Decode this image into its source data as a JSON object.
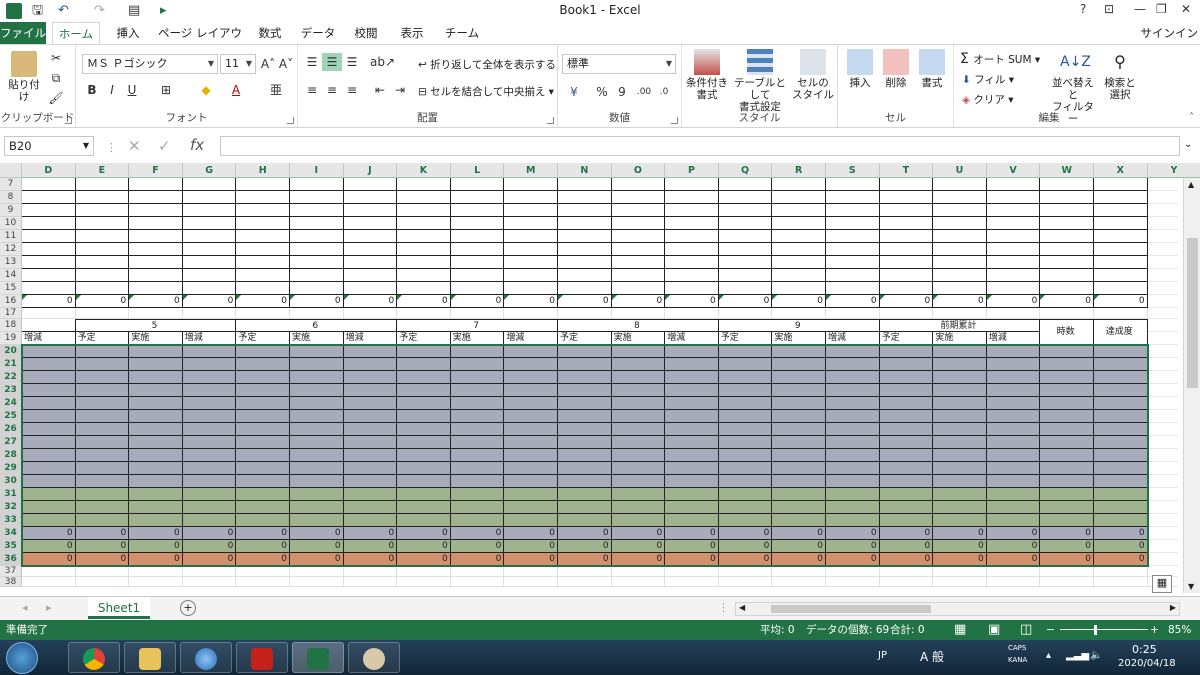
{
  "window": {
    "title": "Book1 - Excel",
    "help": "?",
    "signin": "サインイン"
  },
  "tabs": [
    "ファイル",
    "ホーム",
    "挿入",
    "ページ レイアウト",
    "数式",
    "データ",
    "校閲",
    "表示",
    "チーム"
  ],
  "ribbon": {
    "clipboard": {
      "label": "クリップボード",
      "paste": "貼り付け"
    },
    "font": {
      "label": "フォント",
      "family": "ＭＳ Ｐゴシック",
      "size": "11",
      "bold": "B",
      "italic": "I",
      "underline": "U"
    },
    "alignment": {
      "label": "配置",
      "wrap": "折り返して全体を表示する",
      "merge": "セルを結合して中央揃え"
    },
    "number": {
      "label": "数値",
      "format": "標準",
      "percent": "%",
      "comma": "9"
    },
    "styles": {
      "label": "スタイル",
      "cond1": "条件付き",
      "cond2": "書式",
      "table1": "テーブルとして",
      "table2": "書式設定",
      "cell1": "セルの",
      "cell2": "スタイル"
    },
    "cells": {
      "label": "セル",
      "insert": "挿入",
      "delete": "削除",
      "format": "書式"
    },
    "editing": {
      "label": "編集",
      "autosum": "オート SUM",
      "fill": "フィル",
      "clear": "クリア",
      "sort1": "並べ替えと",
      "sort2": "フィルター",
      "find1": "検索と",
      "find2": "選択"
    }
  },
  "formula_bar": {
    "namebox": "B20",
    "cancel": "✕",
    "enter": "✓",
    "fx": "fx",
    "value": ""
  },
  "columns": [
    "D",
    "E",
    "F",
    "G",
    "H",
    "I",
    "J",
    "K",
    "L",
    "M",
    "N",
    "O",
    "P",
    "Q",
    "R",
    "S",
    "T",
    "U",
    "V",
    "W",
    "X",
    "Y"
  ],
  "rows": [
    "7",
    "8",
    "9",
    "10",
    "11",
    "12",
    "13",
    "14",
    "15",
    "16",
    "17",
    "18",
    "19",
    "20",
    "21",
    "22",
    "23",
    "24",
    "25",
    "26",
    "27",
    "28",
    "29",
    "30",
    "31",
    "32",
    "33",
    "34",
    "35",
    "36",
    "37",
    "38"
  ],
  "sheet": {
    "zero": "0",
    "group_headers": [
      "5",
      "6",
      "7",
      "8",
      "9",
      "前期累計"
    ],
    "sub_headers": [
      "予定",
      "実施",
      "増減"
    ],
    "first_sub": "増減",
    "hours": "時数",
    "rate": "達成度"
  },
  "colors": {
    "gray": "#a7abba",
    "green": "#a0b38f",
    "orange": "#d2906c",
    "accent": "#217346"
  },
  "sheet_tabs": {
    "active": "Sheet1",
    "add": "+"
  },
  "status": {
    "ready": "準備完了",
    "avg": "平均: 0",
    "count": "データの個数: 69",
    "sum": "合計: 0",
    "zoom": "85%"
  },
  "tray": {
    "lang": "JP",
    "ime": "A 般",
    "caps": "CAPS",
    "kana": "KANA",
    "time": "0:25",
    "date": "2020/04/18"
  }
}
